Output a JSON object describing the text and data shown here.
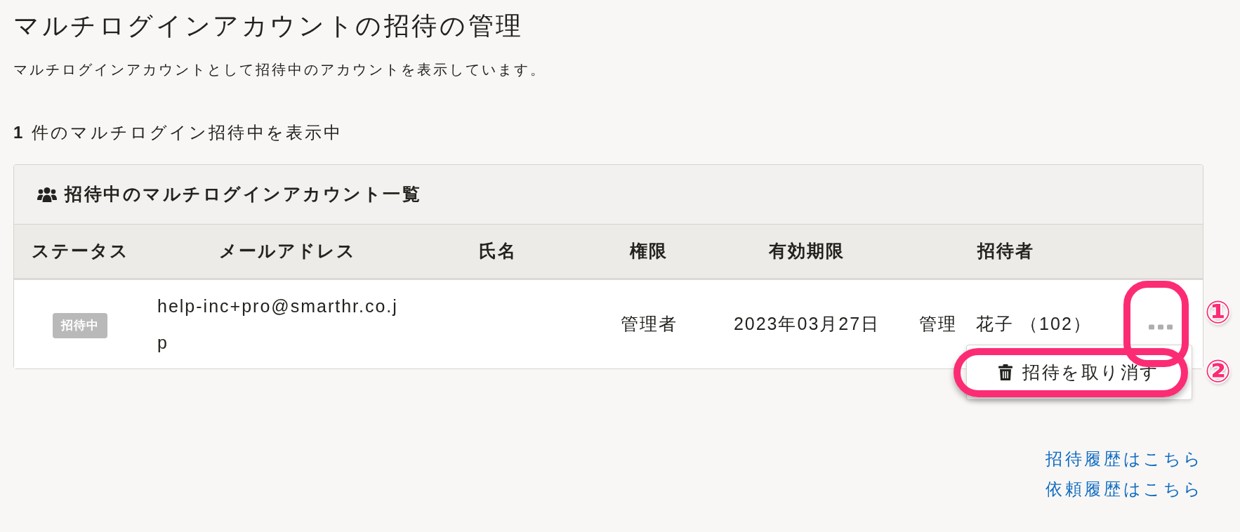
{
  "page": {
    "title": "マルチログインアカウントの招待の管理",
    "description": "マルチログインアカウントとして招待中のアカウントを表示しています。"
  },
  "summary": "**1** 件のマルチログイン招待中を表示中",
  "card": {
    "title": "招待中のマルチログインアカウント一覧",
    "table": {
      "columns": [
        "ステータス",
        "メールアドレス",
        "氏名",
        "権限",
        "有効期限",
        "招待者"
      ],
      "rows": [
        {
          "status": "招待中",
          "email": "help-inc+pro@smarthr.co.jp",
          "role": "管理者",
          "expires": "2023年03月27日",
          "inviter": "管理　花子 （102）",
          "actions": {
            "expanded": true,
            "items": [
              {
                "label": "招待を取り消す"
              }
            ]
          }
        }
      ]
    }
  },
  "callouts": [
    {
      "number": "①"
    },
    {
      "number": "②"
    }
  ],
  "links": [
    {
      "label": "招待履歴はこちら"
    },
    {
      "label": "依頼履歴はこちら"
    }
  ]
}
